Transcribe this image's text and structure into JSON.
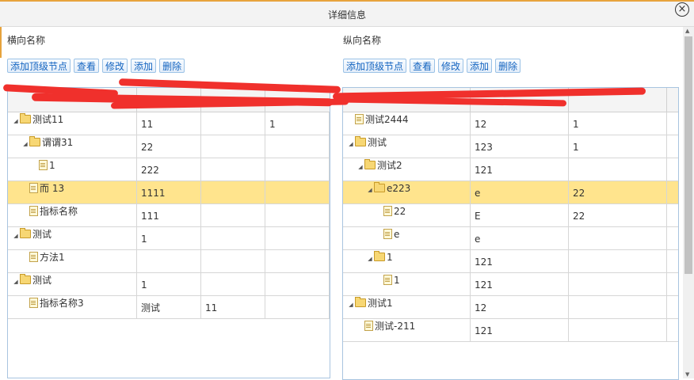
{
  "dialog": {
    "title": "详细信息"
  },
  "left": {
    "section_label": "横向名称",
    "buttons": [
      "添加顶级节点",
      "查看",
      "修改",
      "添加",
      "删除"
    ],
    "rows": [
      {
        "level": 0,
        "type": "folder",
        "name": "测试11",
        "c1": "11",
        "c2": "",
        "c3": "1",
        "selected": false
      },
      {
        "level": 1,
        "type": "folder",
        "name": "谓谓31",
        "c1": "22",
        "c2": "",
        "c3": "",
        "selected": false
      },
      {
        "level": 2,
        "type": "file",
        "name": "1",
        "c1": "222",
        "c2": "",
        "c3": "",
        "selected": false
      },
      {
        "level": 1,
        "type": "file",
        "name": "而 13",
        "c1": "1111",
        "c2": "",
        "c3": "",
        "selected": true
      },
      {
        "level": 1,
        "type": "file",
        "name": "指标名称",
        "c1": "111",
        "c2": "",
        "c3": "",
        "selected": false
      },
      {
        "level": 0,
        "type": "folder",
        "name": "测试",
        "c1": "1",
        "c2": "",
        "c3": "",
        "selected": false
      },
      {
        "level": 1,
        "type": "file",
        "name": "方法1",
        "c1": "",
        "c2": "",
        "c3": "",
        "selected": false
      },
      {
        "level": 0,
        "type": "folder",
        "name": "测试",
        "c1": "1",
        "c2": "",
        "c3": "",
        "selected": false
      },
      {
        "level": 1,
        "type": "file",
        "name": "指标名称3",
        "c1": "测试",
        "c2": "11",
        "c3": "",
        "selected": false
      }
    ]
  },
  "right": {
    "section_label": "纵向名称",
    "buttons": [
      "添加顶级节点",
      "查看",
      "修改",
      "添加",
      "删除"
    ],
    "rows": [
      {
        "level": 0,
        "type": "file",
        "name": "测试2444",
        "c1": "12",
        "c2": "1",
        "selected": false
      },
      {
        "level": 0,
        "type": "folder",
        "name": "测试",
        "c1": "123",
        "c2": "1",
        "selected": false
      },
      {
        "level": 1,
        "type": "folder",
        "name": "测试2",
        "c1": "121",
        "c2": "",
        "selected": false
      },
      {
        "level": 2,
        "type": "folder",
        "name": "e223",
        "c1": "e",
        "c2": "22",
        "selected": true
      },
      {
        "level": 3,
        "type": "file",
        "name": "22",
        "c1": "E",
        "c2": "22",
        "selected": false
      },
      {
        "level": 3,
        "type": "file",
        "name": "e",
        "c1": "e",
        "c2": "",
        "selected": false
      },
      {
        "level": 2,
        "type": "folder",
        "name": "1",
        "c1": "121",
        "c2": "",
        "selected": false
      },
      {
        "level": 3,
        "type": "file",
        "name": "1",
        "c1": "121",
        "c2": "",
        "selected": false
      },
      {
        "level": 0,
        "type": "folder",
        "name": "测试1",
        "c1": "12",
        "c2": "",
        "selected": false
      },
      {
        "level": 1,
        "type": "file",
        "name": "测试-211",
        "c1": "121",
        "c2": "",
        "selected": false
      }
    ]
  },
  "colors": {
    "selected_row": "#ffe48d",
    "button_text": "#1565c0",
    "redaction": "#f0302c"
  }
}
